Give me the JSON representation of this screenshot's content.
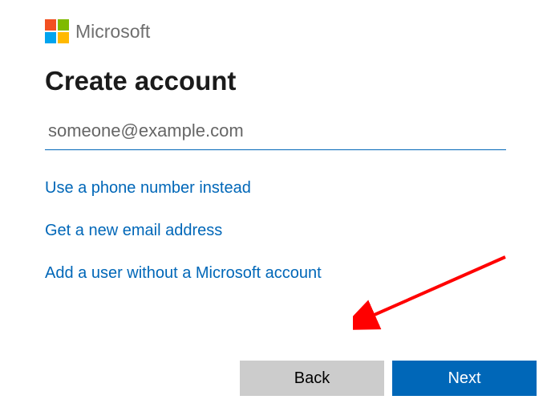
{
  "brand": "Microsoft",
  "title": "Create account",
  "email": {
    "placeholder": "someone@example.com"
  },
  "links": {
    "phone": "Use a phone number instead",
    "newEmail": "Get a new email address",
    "noAccount": "Add a user without a Microsoft account"
  },
  "buttons": {
    "back": "Back",
    "next": "Next"
  }
}
